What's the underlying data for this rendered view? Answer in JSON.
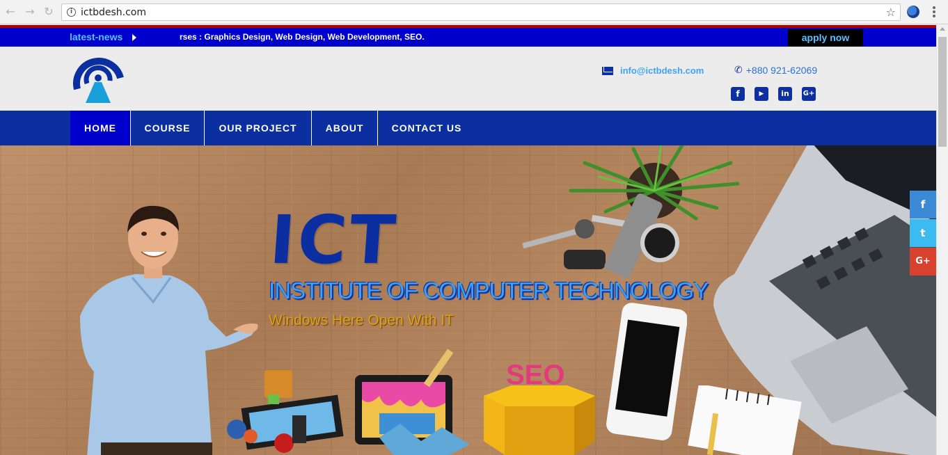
{
  "browser": {
    "url": "ictbdesh.com"
  },
  "topbar": {
    "news_label": "latest-news",
    "news_ticker": "rses : Graphics Design, Web Design, Web Development, SEO.",
    "apply_label": "apply now"
  },
  "header": {
    "email": "info@ictbdesh.com",
    "phone": "+880 921-62069",
    "social_icons": [
      "facebook-icon",
      "youtube-icon",
      "linkedin-icon",
      "google-plus-icon"
    ]
  },
  "nav": {
    "items": [
      {
        "label": "HOME",
        "active": true
      },
      {
        "label": "COURSE",
        "active": false
      },
      {
        "label": "OUR PROJECT",
        "active": false
      },
      {
        "label": "ABOUT",
        "active": false
      },
      {
        "label": "CONTACT US",
        "active": false
      }
    ]
  },
  "hero": {
    "title": "ICT",
    "subtitle": "INSTITUTE OF COMPUTER TECHNOLOGY",
    "tagline": "Windows Here Open With IT",
    "seo_text": "SEO"
  },
  "floating_social": {
    "facebook": "f",
    "twitter": "t",
    "google_plus": "G+"
  },
  "colors": {
    "brand_blue": "#0b2fa0",
    "topbar_blue": "#0000cc",
    "accent_light_blue": "#3ea0f2",
    "topbar_border_red": "#b00000"
  }
}
